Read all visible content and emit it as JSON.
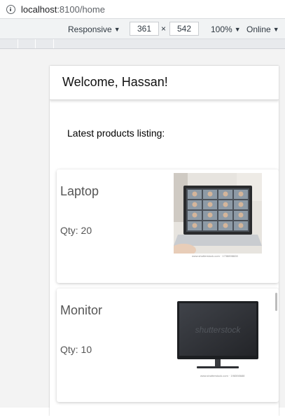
{
  "browser": {
    "url_host": "localhost",
    "url_path": ":8100/home"
  },
  "devtools": {
    "device": "Responsive",
    "width": "361",
    "separator": "×",
    "height": "542",
    "zoom": "100%",
    "network": "Online"
  },
  "app": {
    "header_title": "Welcome, Hassan!",
    "listing_title": "Latest products listing:",
    "products": [
      {
        "name": "Laptop",
        "qty_label": "Qty: 20",
        "image_caption": "www.shutterstock.com · 1738898828",
        "image": "laptop-video-call-photo"
      },
      {
        "name": "Monitor",
        "qty_label": "Qty: 10",
        "image_caption": "www.shutterstock.com · 196598688",
        "image": "monitor-photo",
        "image_watermark": "shutterstock"
      }
    ]
  }
}
